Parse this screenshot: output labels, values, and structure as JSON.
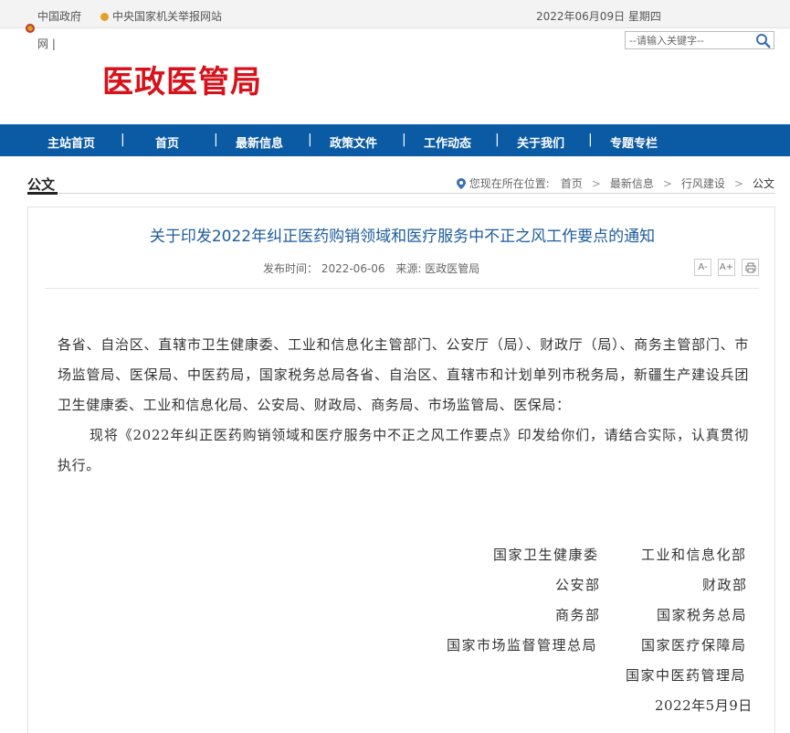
{
  "topbar": {
    "gov_link": "中国政府",
    "report_link": "中央国家机关举报网站",
    "date": "2022年06月09日 星期四"
  },
  "header": {
    "wang": "网 |",
    "site_logo": "医政医管局",
    "search_placeholder": "--请输入关键字--"
  },
  "nav": {
    "items": [
      {
        "label": "主站首页"
      },
      {
        "label": "首页"
      },
      {
        "label": "最新信息"
      },
      {
        "label": "政策文件"
      },
      {
        "label": "工作动态"
      },
      {
        "label": "关于我们"
      },
      {
        "label": "专题专栏"
      }
    ],
    "separator": "|"
  },
  "breadcrumb": {
    "section": "公文",
    "prefix": "您现在所在位置:",
    "items": [
      "首页",
      "最新信息",
      "行风建设",
      "公文"
    ]
  },
  "article": {
    "title": "关于印发2022年纠正医药购销领域和医疗服务中不正之风工作要点的通知",
    "publish_time": "发布时间：  2022-06-06",
    "source": "来源: 医政医管局",
    "tools": {
      "font_small": "A-",
      "font_large": "A+",
      "print": "print-icon"
    },
    "addressee": "各省、自治区、直辖市卫生健康委、工业和信息化主管部门、公安厅（局）、财政厅（局）、商务主管部门、市场监管局、医保局、中医药局，国家税务总局各省、自治区、直辖市和计划单列市税务局，新疆生产建设兵团卫生健康委、工业和信息化局、公安局、财政局、商务局、市场监管局、医保局：",
    "body": "现将《2022年纠正医药购销领域和医疗服务中不正之风工作要点》印发给你们，请结合实际，认真贯彻执行。",
    "signatures": [
      "国家卫生健康委",
      "工业和信息化部",
      "公安部",
      "财政部",
      "商务部",
      "国家税务总局",
      "国家市场监督管理总局",
      "国家医疗保障局",
      "国家中医药管理局"
    ],
    "date": "2022年5月9日"
  },
  "colors": {
    "nav_bg": "#0b5aa4",
    "logo": "#d7121b",
    "title": "#1d5c9b"
  }
}
